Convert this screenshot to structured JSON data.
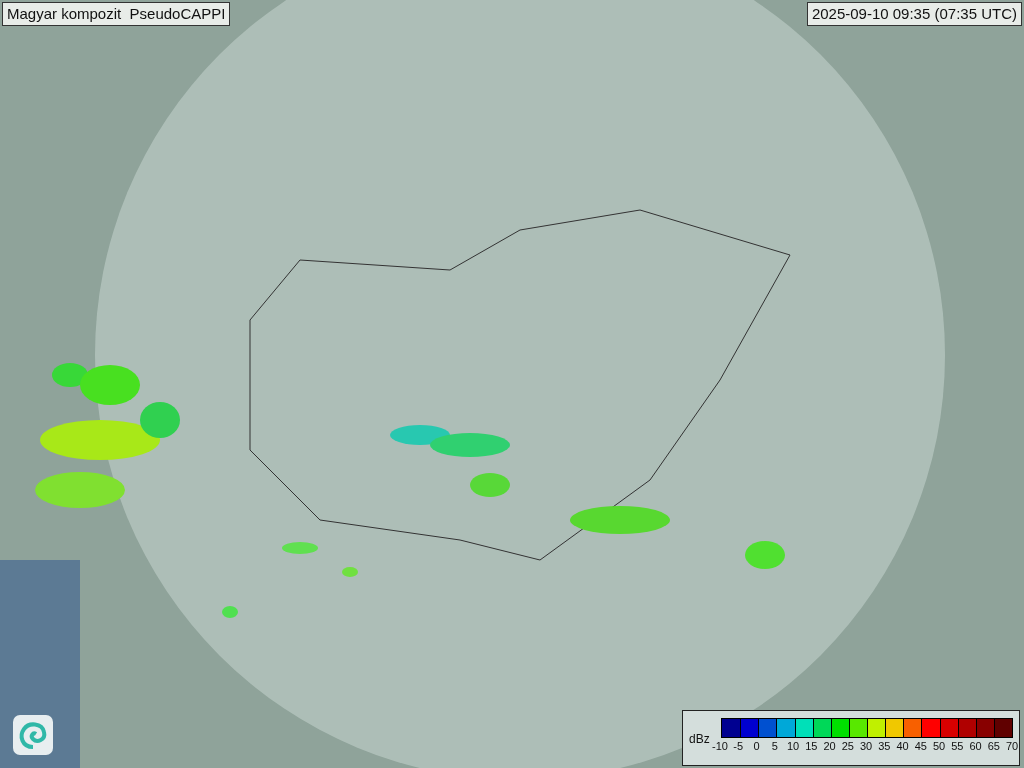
{
  "title": "Magyar kompozit  PseudoCAPPI",
  "timestamp": "2025-09-10 09:35 (07:35 UTC)",
  "legend": {
    "unit": "dBz",
    "bins": [
      {
        "color": "#000090"
      },
      {
        "color": "#0000d0"
      },
      {
        "color": "#0050d0"
      },
      {
        "color": "#00a8d8"
      },
      {
        "color": "#00e0b8"
      },
      {
        "color": "#00d858"
      },
      {
        "color": "#00e000"
      },
      {
        "color": "#58e800"
      },
      {
        "color": "#c0f000"
      },
      {
        "color": "#f0c800"
      },
      {
        "color": "#f86000"
      },
      {
        "color": "#ff0000"
      },
      {
        "color": "#d80000"
      },
      {
        "color": "#b00000"
      },
      {
        "color": "#880000"
      },
      {
        "color": "#600000"
      }
    ],
    "ticks": [
      "-10",
      "-5",
      "0",
      "5",
      "10",
      "15",
      "20",
      "25",
      "30",
      "35",
      "40",
      "45",
      "50",
      "55",
      "60",
      "65",
      "70"
    ]
  }
}
